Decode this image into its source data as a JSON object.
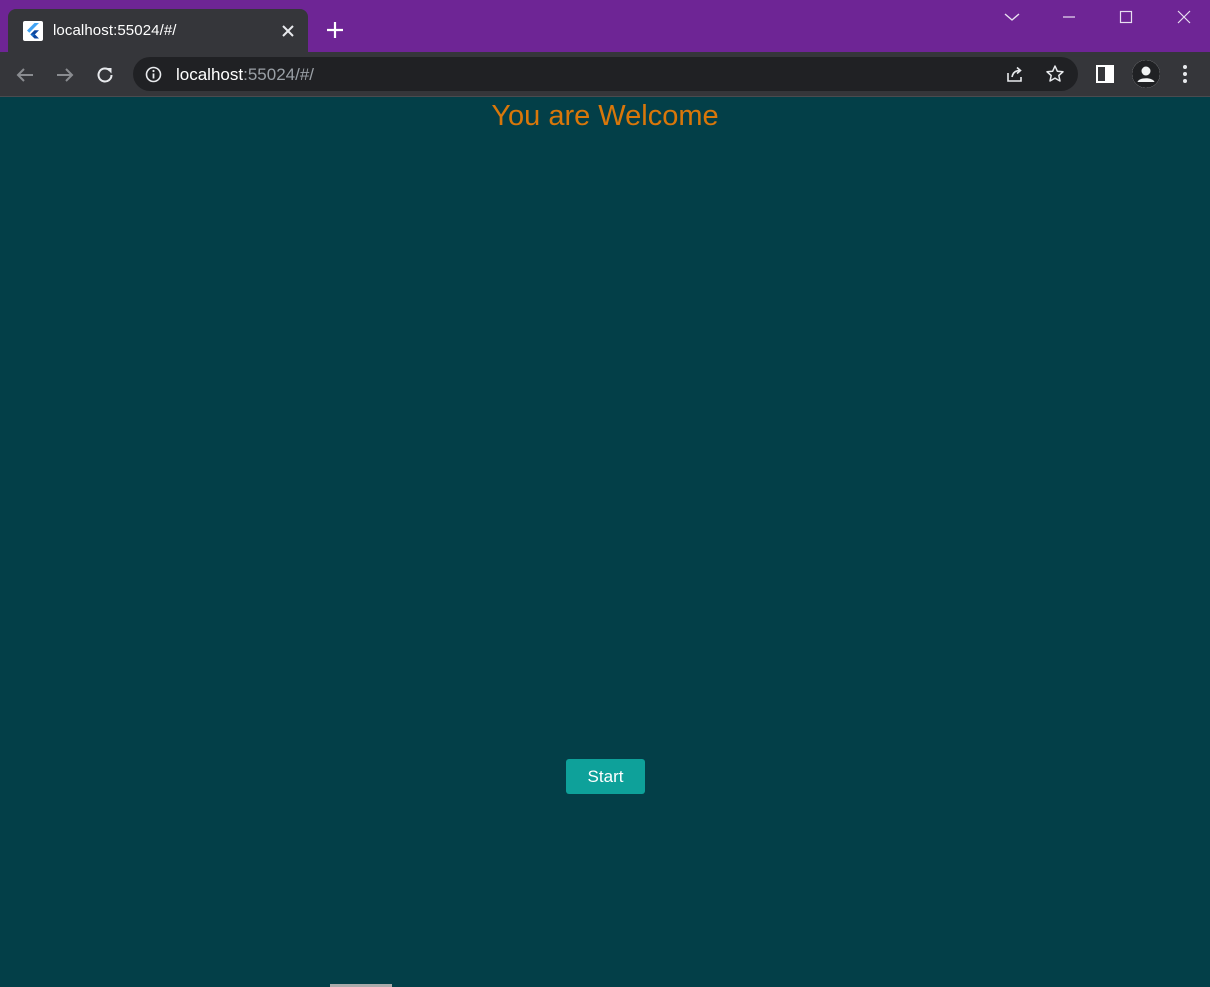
{
  "browser": {
    "tab": {
      "title": "localhost:55024/#/",
      "favicon": "flutter-icon"
    },
    "address": {
      "host": "localhost",
      "rest": ":55024/#/"
    },
    "icons": {
      "back": "arrow-left-icon",
      "forward": "arrow-right-icon",
      "reload": "reload-icon",
      "site_info": "info-icon",
      "share": "share-icon",
      "bookmark": "star-icon",
      "side_panel": "side-panel-icon",
      "profile": "avatar-icon",
      "menu": "kebab-menu-icon"
    },
    "colors": {
      "frame": "#6e2595",
      "tab": "#35363a",
      "omnibox": "#202124"
    }
  },
  "page": {
    "title": "You are Welcome",
    "start_label": "Start",
    "colors": {
      "background": "#033f48",
      "title": "#d9770a",
      "button": "#0ea19a"
    }
  }
}
